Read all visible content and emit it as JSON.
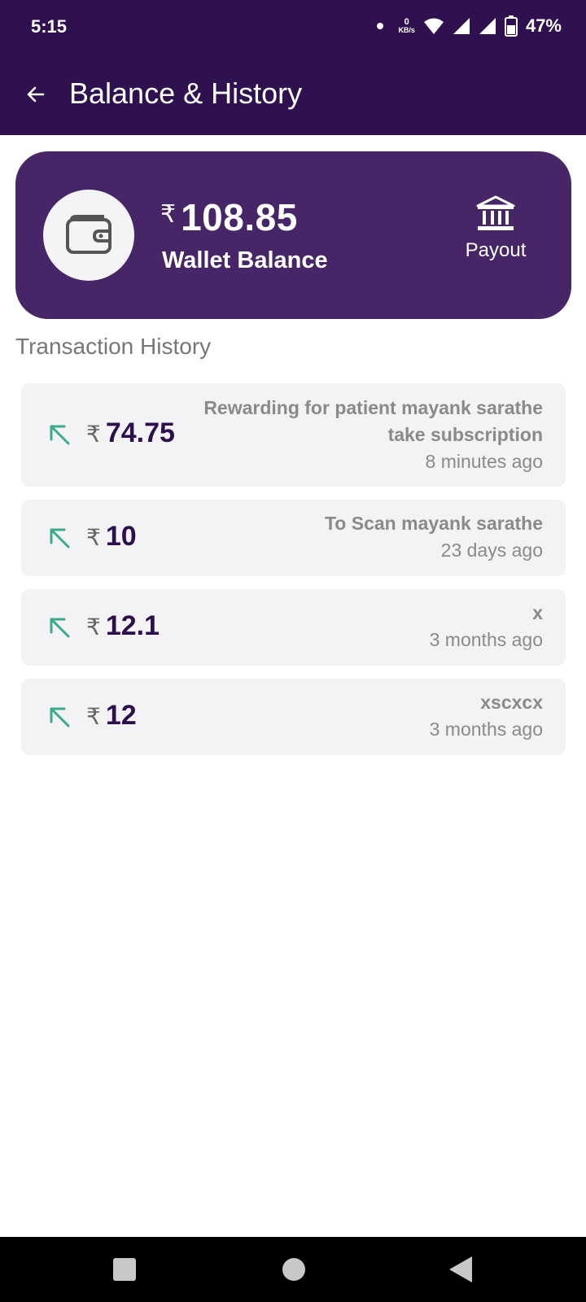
{
  "status_bar": {
    "time": "5:15",
    "net_speed_value": "0",
    "net_speed_unit": "KB/s",
    "battery": "47%"
  },
  "app_bar": {
    "title": "Balance & History",
    "back_icon": "arrow-left-icon"
  },
  "wallet": {
    "currency": "₹",
    "balance": "108.85",
    "label": "Wallet Balance",
    "wallet_icon": "wallet-icon",
    "payout_label": "Payout",
    "payout_icon": "bank-icon"
  },
  "history": {
    "title": "Transaction History",
    "transactions": [
      {
        "amount": "74.75",
        "description_line1": "Rewarding for patient mayank sarathe",
        "description_line2": "take subscription",
        "time": "8 minutes ago",
        "direction": "incoming"
      },
      {
        "amount": "10",
        "description_line1": "To Scan mayank sarathe",
        "time": "23 days ago",
        "direction": "incoming"
      },
      {
        "amount": "12.1",
        "description_line1": "x",
        "time": "3 months ago",
        "direction": "incoming"
      },
      {
        "amount": "12",
        "description_line1": "xscxcx",
        "time": "3 months ago",
        "direction": "incoming"
      }
    ]
  },
  "colors": {
    "header": "#2f1150",
    "card": "#462666",
    "arrow": "#3aaa8c",
    "amount": "#2d0f4d"
  }
}
